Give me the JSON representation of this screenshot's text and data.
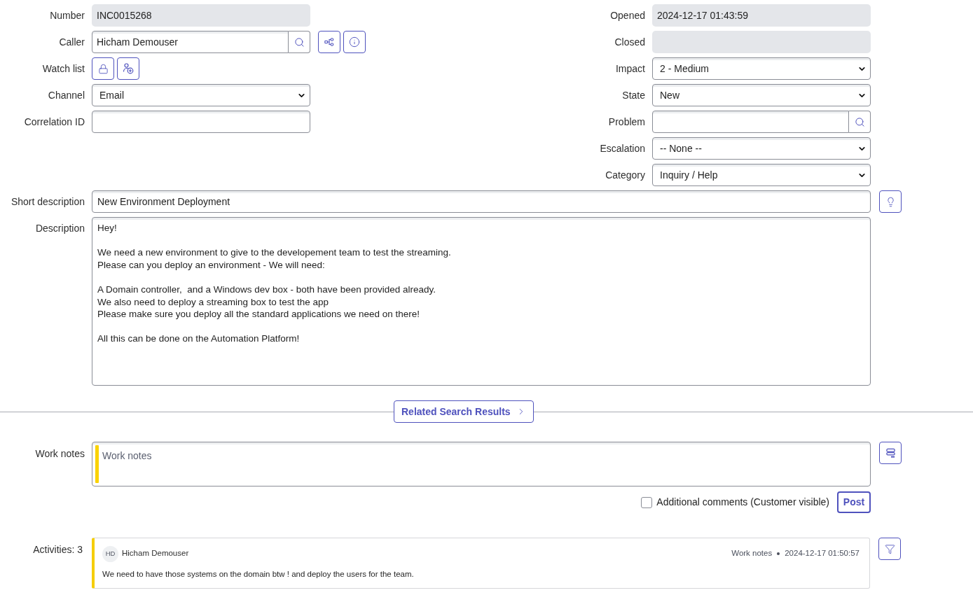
{
  "left_fields": [
    {
      "kind": "readonly",
      "label": "Number",
      "value": "INC0015268"
    },
    {
      "kind": "caller",
      "label": "Caller",
      "value": "Hicham Demouser"
    },
    {
      "kind": "watchlist",
      "label": "Watch list"
    },
    {
      "kind": "select",
      "label": "Channel",
      "value": "Email"
    },
    {
      "kind": "text",
      "label": "Correlation ID"
    }
  ],
  "right_fields": [
    {
      "kind": "readonly",
      "label": "Opened",
      "value": "2024-12-17 01:43:59"
    },
    {
      "kind": "readonly",
      "label": "Closed"
    },
    {
      "kind": "select",
      "label": "Impact",
      "value": "2 - Medium"
    },
    {
      "kind": "select",
      "label": "State",
      "value": "New"
    },
    {
      "kind": "reference",
      "label": "Problem"
    },
    {
      "kind": "select",
      "label": "Escalation",
      "value": "-- None --"
    },
    {
      "kind": "select",
      "label": "Category",
      "value": "Inquiry / Help"
    }
  ],
  "short_description": {
    "label": "Short description",
    "value": "New Environment Deployment"
  },
  "description": {
    "label": "Description",
    "value": "Hey!\n\nWe need a new environment to give to the developement team to test the streaming.\nPlease can you deploy an environment - We will need:\n\nA Domain controller,  and a Windows dev box - both have been provided already.\nWe also need to deploy a streaming box to test the app\nPlease make sure you deploy all the standard applications we need on there!\n\nAll this can be done on the Automation Platform!"
  },
  "related_search": {
    "label": "Related Search Results"
  },
  "work_notes": {
    "label": "Work notes",
    "placeholder": "Work notes"
  },
  "additional_comments": {
    "label": "Additional comments (Customer visible)",
    "checked": false
  },
  "post_button": {
    "label": "Post"
  },
  "activities": {
    "label": "Activities: 3",
    "entries": [
      {
        "initials": "HD",
        "author": "Hicham Demouser",
        "type": "Work notes",
        "time": "2024-12-17 01:50:57",
        "text": "We need to have those systems on the domain btw ! and deploy the users for the team."
      }
    ]
  }
}
